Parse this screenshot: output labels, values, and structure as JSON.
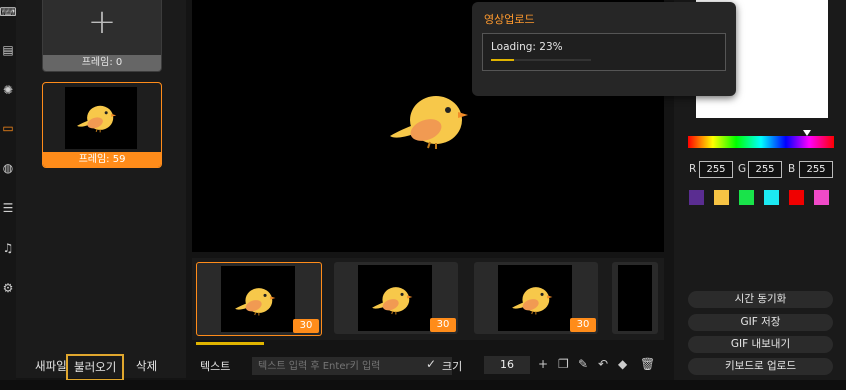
{
  "rail": {
    "icons": [
      "keyboard-icon",
      "document-icon",
      "lightbulb-icon",
      "screen-icon",
      "globe-icon",
      "lines-icon",
      "music-icon",
      "settings-icon"
    ]
  },
  "frames_panel": {
    "frame0_label": "프레임: 0",
    "frame59_label": "프레임: 59"
  },
  "bottom_actions": {
    "new_file": "새파일",
    "load": "불러오기",
    "delete": "삭제"
  },
  "timeline": {
    "frames": [
      {
        "duration": "30"
      },
      {
        "duration": "30"
      },
      {
        "duration": "30"
      }
    ],
    "progress": 0.14
  },
  "text_toolbar": {
    "text_label": "텍스트",
    "input_placeholder": "텍스트 입력 후 Enter키 입력",
    "size_label": "크기",
    "size_value": "16"
  },
  "color_picker": {
    "r_label": "R",
    "r_value": "255",
    "g_label": "G",
    "g_value": "255",
    "b_label": "B",
    "b_value": "255",
    "swatches": [
      "#5a2d91",
      "#f6c344",
      "#19e34a",
      "#1ce9f2",
      "#f00000",
      "#f04ac8"
    ]
  },
  "right_buttons": {
    "sync": "시간 동기화",
    "gif_save": "GIF 저장",
    "gif_export": "GIF 내보내기",
    "keyboard_upload": "키보드로 업로드"
  },
  "upload_popup": {
    "title": "영상업로드",
    "status": "Loading: 23%",
    "progress": 0.23
  },
  "colors": {
    "accent": "#ff8c1a",
    "highlight": "#e0a72e",
    "bird_body": "#f7c84a",
    "bird_wing": "#f19a52",
    "beak": "#f28c28"
  }
}
